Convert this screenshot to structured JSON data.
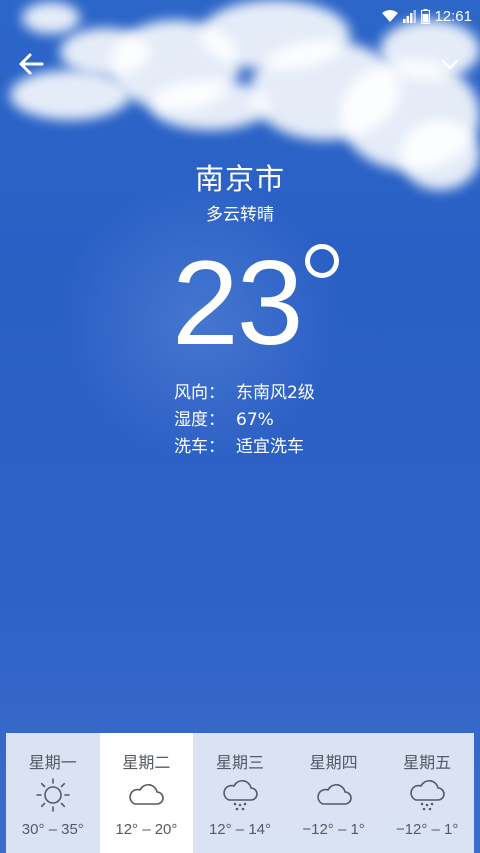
{
  "status_bar": {
    "time": "12:61",
    "icons": [
      "wifi-icon",
      "signal-icon",
      "battery-icon"
    ]
  },
  "header": {
    "back_icon": "arrow-left-icon",
    "dropdown_icon": "chevron-down-icon"
  },
  "weather": {
    "city": "南京市",
    "condition": "多云转晴",
    "temperature": "23",
    "details": [
      {
        "label": "风向：",
        "value": "东南风2级"
      },
      {
        "label": "湿度：",
        "value": "67%"
      },
      {
        "label": "洗车：",
        "value": "适宜洗车"
      }
    ]
  },
  "forecast": [
    {
      "day": "星期一",
      "icon": "sun-icon",
      "range": "30° – 35°",
      "selected": false
    },
    {
      "day": "星期二",
      "icon": "cloud-icon",
      "range": "12° – 20°",
      "selected": true
    },
    {
      "day": "星期三",
      "icon": "cloud-rain-icon",
      "range": "12° – 14°",
      "selected": false
    },
    {
      "day": "星期四",
      "icon": "cloud-icon",
      "range": "−12° – 1°",
      "selected": false
    },
    {
      "day": "星期五",
      "icon": "cloud-rain-icon",
      "range": "−12° – 1°",
      "selected": false
    }
  ],
  "colors": {
    "sky": "#2c66c8",
    "forecast_bg": "#e6ecf6",
    "forecast_selected": "#ffffff",
    "forecast_text": "#555a63"
  }
}
